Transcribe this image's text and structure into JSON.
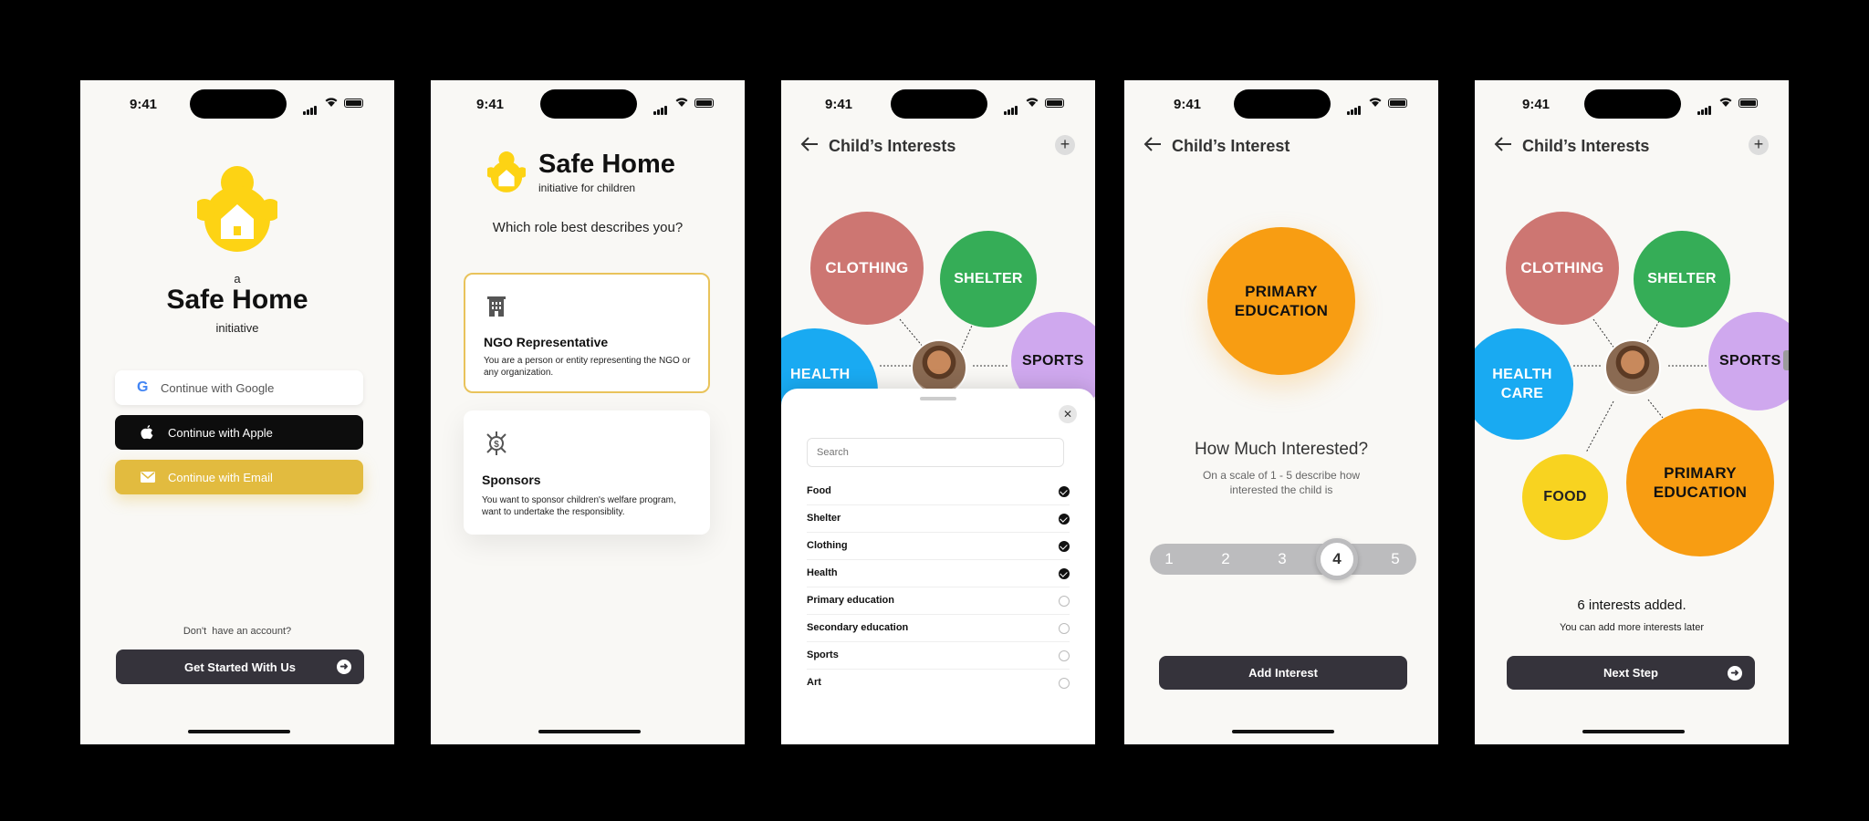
{
  "status": {
    "time": "9:41"
  },
  "screen1": {
    "prefix": "a",
    "brand": "Safe Home",
    "suffix": "initiative",
    "google_label": "Continue with Google",
    "apple_label": "Continue with Apple",
    "email_label": "Continue with Email",
    "no_account": "Don't  have an account?",
    "get_started": "Get Started With Us"
  },
  "screen2": {
    "brand": "Safe Home",
    "tagline": "initiative for children",
    "question": "Which role best describes you?",
    "roles": [
      {
        "title": "NGO Representative",
        "desc": "You are a person or entity representing the NGO or any organization."
      },
      {
        "title": "Sponsors",
        "desc": "You want to sponsor children's welfare program, want to undertake the responsiblity."
      }
    ]
  },
  "screen3": {
    "title": "Child’s Interests",
    "bubbles": [
      "CLOTHING",
      "SHELTER",
      "HEALTH",
      "SPORTS"
    ],
    "search_placeholder": "Search",
    "items": [
      {
        "label": "Food",
        "checked": true
      },
      {
        "label": "Shelter",
        "checked": true
      },
      {
        "label": "Clothing",
        "checked": true
      },
      {
        "label": "Health",
        "checked": true
      },
      {
        "label": "Primary education",
        "checked": false
      },
      {
        "label": "Secondary education",
        "checked": false
      },
      {
        "label": "Sports",
        "checked": false
      },
      {
        "label": "Art",
        "checked": false
      }
    ]
  },
  "screen4": {
    "title": "Child’s Interest",
    "bubble": "PRIMARY EDUCATION",
    "question": "How Much Interested?",
    "hint": "On a scale of 1 - 5 describe how interested the child is",
    "scale": [
      "1",
      "2",
      "3",
      "4",
      "5"
    ],
    "selected": 4,
    "add_label": "Add Interest"
  },
  "screen5": {
    "title": "Child’s Interests",
    "bubbles": [
      "CLOTHING",
      "SHELTER",
      "HEALTH CARE",
      "SPORTS",
      "FOOD",
      "PRIMARY EDUCATION"
    ],
    "count_text": "6 interests added.",
    "later_text": "You can add more interests later",
    "next_label": "Next Step"
  },
  "colors": {
    "yellow": "#fdd314",
    "dark": "#35333b",
    "clothing": "#cd7672",
    "shelter": "#35ad57",
    "health": "#19aaf2",
    "sports": "#cfa8ee",
    "education": "#f89d12",
    "food": "#f8d320",
    "email": "#e2bb3f"
  }
}
